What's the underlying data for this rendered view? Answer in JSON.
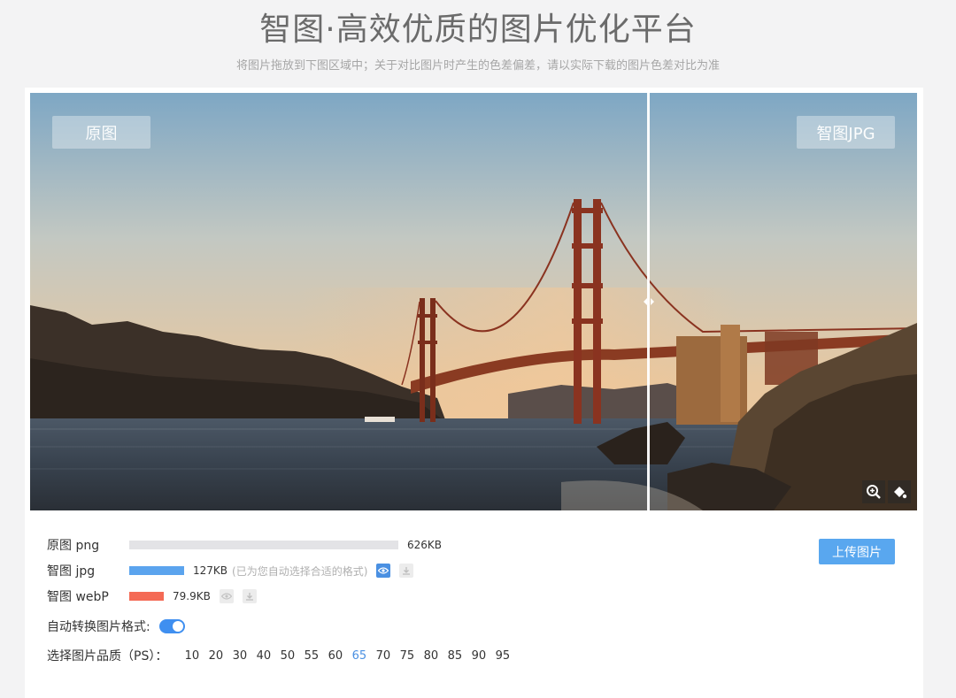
{
  "header": {
    "title": "智图·高效优质的图片优化平台",
    "subtitle": "将图片拖放到下图区域中；关于对比图片时产生的色差偏差，请以实际下载的图片色差对比为准"
  },
  "compare": {
    "left_tag": "原图",
    "right_tag": "智图JPG",
    "split_fraction": 0.697,
    "tools": [
      "zoom-in-icon",
      "color-drop-icon"
    ]
  },
  "results": {
    "rows": [
      {
        "label": "原图 png",
        "size": "626KB",
        "bar_fraction": 1.0,
        "bar_color": "#e3e3e6"
      },
      {
        "label": "智图 jpg",
        "size": "127KB",
        "note": "(已为您自动选择合适的格式)",
        "bar_fraction": 0.203,
        "bar_color": "#5ba4ee",
        "preview_active": true
      },
      {
        "label": "智图 webP",
        "size": "79.9KB",
        "bar_fraction": 0.128,
        "bar_color": "#f46a55",
        "preview_active": false
      }
    ],
    "upload_label": "上传图片"
  },
  "settings": {
    "auto_label": "自动转换图片格式:",
    "auto_enabled": true,
    "quality_label": "选择图片品质（PS）：",
    "quality_options": [
      "10",
      "20",
      "30",
      "40",
      "50",
      "55",
      "60",
      "65",
      "70",
      "75",
      "80",
      "85",
      "90",
      "95"
    ],
    "quality_selected": "65"
  },
  "colors": {
    "accent": "#4a90e2",
    "button": "#59a7ef",
    "webp_bar": "#f46a55",
    "jpg_bar": "#5ba4ee"
  }
}
